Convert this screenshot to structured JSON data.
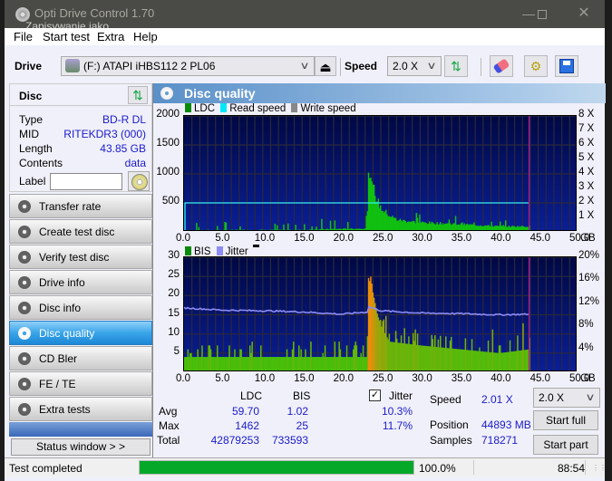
{
  "window": {
    "title": "Opti Drive Control 1.70",
    "subtitle": "Zapisywanie jako",
    "controls": [
      "minimize",
      "maximize",
      "close"
    ]
  },
  "menu": [
    "File",
    "Start test",
    "Extra",
    "Help"
  ],
  "toolbar": {
    "drive_label": "Drive",
    "drive_value": "(F:)   ATAPI iHBS112   2 PL06",
    "speed_label": "Speed",
    "speed_value": "2.0 X",
    "icons": [
      "eject-icon",
      "refresh-icon",
      "erase-icon",
      "settings-icon",
      "save-icon"
    ]
  },
  "disc": {
    "header": "Disc",
    "rows": [
      {
        "key": "Type",
        "value": "BD-R DL"
      },
      {
        "key": "MID",
        "value": "RITEKDR3 (000)"
      },
      {
        "key": "Length",
        "value": "43.85 GB"
      },
      {
        "key": "Contents",
        "value": "data"
      }
    ],
    "label_key": "Label",
    "label_value": ""
  },
  "nav": {
    "items": [
      {
        "label": "Transfer rate",
        "active": false
      },
      {
        "label": "Create test disc",
        "active": false
      },
      {
        "label": "Verify test disc",
        "active": false
      },
      {
        "label": "Drive info",
        "active": false
      },
      {
        "label": "Disc info",
        "active": false
      },
      {
        "label": "Disc quality",
        "active": true
      },
      {
        "label": "CD Bler",
        "active": false
      },
      {
        "label": "FE / TE",
        "active": false
      },
      {
        "label": "Extra tests",
        "active": false
      }
    ],
    "status_window": "Status window > >"
  },
  "panel": {
    "title": "Disc quality",
    "colors": {
      "ldc": "#0a8a0a",
      "read_speed": "#00e8f8",
      "write_speed": "#888888",
      "bis": "#0a8a0a",
      "jitter": "#8c8cf4",
      "marker": "#a0208c"
    }
  },
  "chart_data": [
    {
      "type": "bar",
      "title": "LDC",
      "legend": [
        "LDC",
        "Read speed",
        "Write speed"
      ],
      "legend_placement": "top-left",
      "xlabel": "GB",
      "x_ticks": [
        "0.0",
        "5.0",
        "10.0",
        "15.0",
        "20.0",
        "25.0",
        "30.0",
        "35.0",
        "40.0",
        "45.0",
        "50.0"
      ],
      "xlim": [
        0,
        50
      ],
      "ylim": [
        0,
        2000
      ],
      "y_ticks": [
        "2000",
        "1500",
        "1000",
        "500"
      ],
      "y2_ticks": [
        "8 X",
        "7 X",
        "6 X",
        "5 X",
        "4 X",
        "3 X",
        "2 X",
        "1 X"
      ],
      "y2lim": [
        0,
        8
      ],
      "end_marker_gb": 43.85,
      "ldc_profile": [
        [
          0,
          30
        ],
        [
          5,
          35
        ],
        [
          10,
          35
        ],
        [
          15,
          35
        ],
        [
          17,
          45
        ],
        [
          20,
          55
        ],
        [
          23.2,
          60
        ],
        [
          23.3,
          1462
        ],
        [
          23.5,
          880
        ],
        [
          24,
          780
        ],
        [
          24.5,
          560
        ],
        [
          25,
          420
        ],
        [
          26,
          300
        ],
        [
          27,
          220
        ],
        [
          28,
          200
        ],
        [
          30,
          170
        ],
        [
          35,
          140
        ],
        [
          40,
          100
        ],
        [
          43.85,
          100
        ]
      ],
      "read_speed_x": 2.0,
      "grid": true
    },
    {
      "type": "bar",
      "title": "BIS / Jitter",
      "legend": [
        "BIS",
        "Jitter"
      ],
      "legend_placement": "top-left",
      "xlabel": "GB",
      "x_ticks": [
        "0.0",
        "5.0",
        "10.0",
        "15.0",
        "20.0",
        "25.0",
        "30.0",
        "35.0",
        "40.0",
        "45.0",
        "50.0"
      ],
      "xlim": [
        0,
        50
      ],
      "ylim": [
        0,
        30
      ],
      "y_ticks": [
        "30",
        "25",
        "20",
        "15",
        "10",
        "5"
      ],
      "y2_ticks": [
        "20%",
        "16%",
        "12%",
        "8%",
        "4%"
      ],
      "y2lim": [
        0,
        20
      ],
      "end_marker_gb": 43.85,
      "bis_profile": [
        [
          0,
          4
        ],
        [
          10,
          4
        ],
        [
          20,
          4
        ],
        [
          23.2,
          4
        ],
        [
          23.3,
          25
        ],
        [
          23.8,
          22
        ],
        [
          24.5,
          15
        ],
        [
          25,
          12
        ],
        [
          26,
          8
        ],
        [
          30,
          7
        ],
        [
          35,
          6
        ],
        [
          40,
          5
        ],
        [
          43.85,
          6
        ]
      ],
      "jitter_profile": [
        [
          0,
          11.2
        ],
        [
          5,
          10.8
        ],
        [
          10,
          10.7
        ],
        [
          15,
          10.5
        ],
        [
          20,
          10.1
        ],
        [
          23.3,
          10.5
        ],
        [
          23.5,
          11.4
        ],
        [
          25,
          10.7
        ],
        [
          30,
          10.3
        ],
        [
          35,
          10.2
        ],
        [
          40,
          10.0
        ],
        [
          43.85,
          10.1
        ]
      ],
      "grid": true
    }
  ],
  "stats": {
    "col_ldc": "LDC",
    "col_bis": "BIS",
    "rows": [
      {
        "label": "Avg",
        "ldc": "59.70",
        "bis": "1.02",
        "jitter": "10.3%"
      },
      {
        "label": "Max",
        "ldc": "1462",
        "bis": "25",
        "jitter": "11.7%"
      },
      {
        "label": "Total",
        "ldc": "42879253",
        "bis": "733593"
      }
    ],
    "jitter_label": "Jitter",
    "jitter_checked": true,
    "speed_label": "Speed",
    "speed_value": "2.01 X",
    "position_label": "Position",
    "position_value": "44893 MB",
    "samples_label": "Samples",
    "samples_value": "718271",
    "speed_select": "2.0 X",
    "start_full": "Start full",
    "start_part": "Start part"
  },
  "statusbar": {
    "text": "Test completed",
    "progress_percent": 100,
    "progress_label": "100.0%",
    "time": "88:54"
  }
}
